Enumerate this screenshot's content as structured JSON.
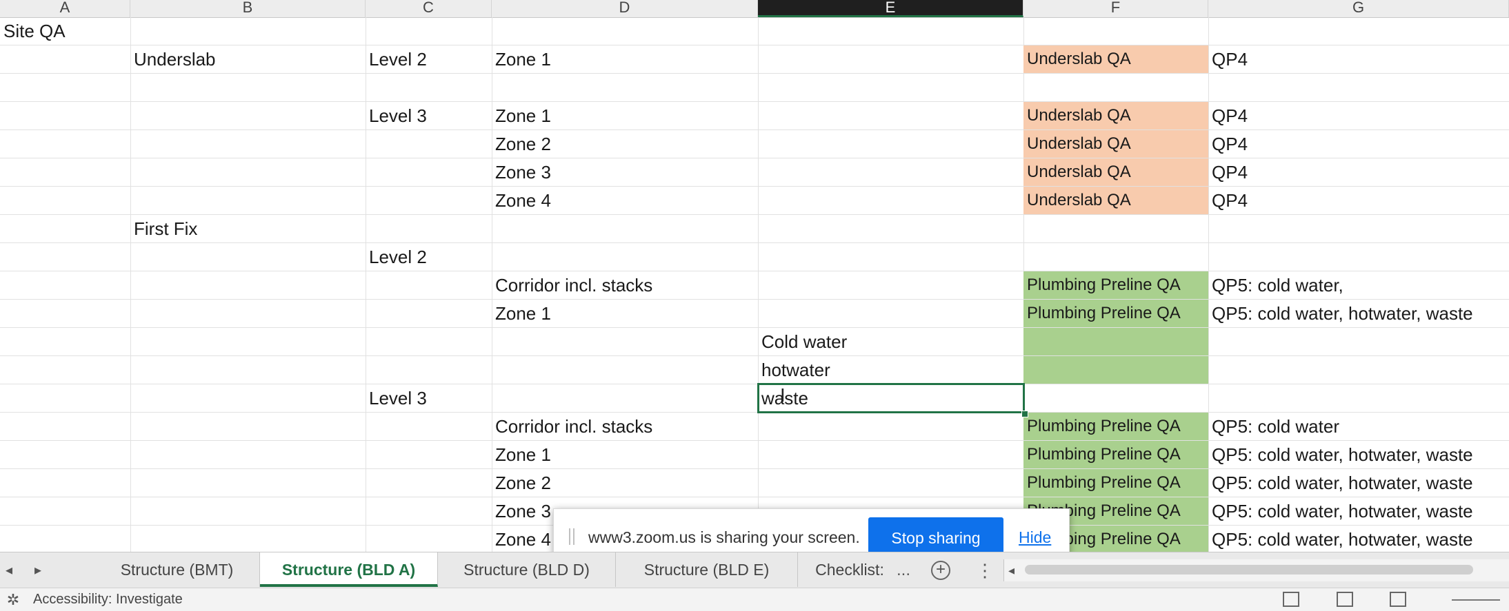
{
  "columns": [
    "A",
    "B",
    "C",
    "D",
    "E",
    "F",
    "G"
  ],
  "selected_column": "E",
  "rows": [
    {
      "a": "Site QA",
      "b": "",
      "c": "",
      "d": "",
      "e": "",
      "f": "",
      "f_fill": "",
      "g": ""
    },
    {
      "a": "",
      "b": "Underslab",
      "c": "Level 2",
      "d": "Zone 1",
      "e": "",
      "f": "Underslab QA",
      "f_fill": "orange",
      "g": "QP4"
    },
    {
      "a": "",
      "b": "",
      "c": "",
      "d": "",
      "e": "",
      "f": "",
      "f_fill": "",
      "g": ""
    },
    {
      "a": "",
      "b": "",
      "c": "Level 3",
      "d": "Zone 1",
      "e": "",
      "f": "Underslab QA",
      "f_fill": "orange",
      "g": "QP4"
    },
    {
      "a": "",
      "b": "",
      "c": "",
      "d": "Zone 2",
      "e": "",
      "f": "Underslab QA",
      "f_fill": "orange",
      "g": "QP4"
    },
    {
      "a": "",
      "b": "",
      "c": "",
      "d": "Zone 3",
      "e": "",
      "f": "Underslab QA",
      "f_fill": "orange",
      "g": "QP4"
    },
    {
      "a": "",
      "b": "",
      "c": "",
      "d": "Zone 4",
      "e": "",
      "f": "Underslab QA",
      "f_fill": "orange",
      "g": "QP4"
    },
    {
      "a": "",
      "b": "First Fix",
      "c": "",
      "d": "",
      "e": "",
      "f": "",
      "f_fill": "",
      "g": ""
    },
    {
      "a": "",
      "b": "",
      "c": "Level 2",
      "d": "",
      "e": "",
      "f": "",
      "f_fill": "",
      "g": ""
    },
    {
      "a": "",
      "b": "",
      "c": "",
      "d": "Corridor incl. stacks",
      "e": "",
      "f": "Plumbing Preline QA",
      "f_fill": "green",
      "g": "QP5: cold water,"
    },
    {
      "a": "",
      "b": "",
      "c": "",
      "d": "Zone 1",
      "e": "",
      "f": "Plumbing Preline QA",
      "f_fill": "green",
      "g": "QP5: cold water, hotwater, waste"
    },
    {
      "a": "",
      "b": "",
      "c": "",
      "d": "",
      "e": "Cold water",
      "f": "",
      "f_fill": "green",
      "g": ""
    },
    {
      "a": "",
      "b": "",
      "c": "",
      "d": "",
      "e": "hotwater",
      "f": "",
      "f_fill": "green",
      "g": ""
    },
    {
      "a": "",
      "b": "",
      "c": "Level 3",
      "d": "",
      "e": "waste",
      "f": "",
      "f_fill": "",
      "g": ""
    },
    {
      "a": "",
      "b": "",
      "c": "",
      "d": "Corridor incl. stacks",
      "e": "",
      "f": "Plumbing Preline QA",
      "f_fill": "green",
      "g": "QP5: cold water"
    },
    {
      "a": "",
      "b": "",
      "c": "",
      "d": "Zone 1",
      "e": "",
      "f": "Plumbing Preline QA",
      "f_fill": "green",
      "g": "QP5: cold water, hotwater, waste"
    },
    {
      "a": "",
      "b": "",
      "c": "",
      "d": "Zone 2",
      "e": "",
      "f": "Plumbing Preline QA",
      "f_fill": "green",
      "g": "QP5: cold water, hotwater, waste"
    },
    {
      "a": "",
      "b": "",
      "c": "",
      "d": "Zone 3",
      "e": "",
      "f": "Plumbing Preline QA",
      "f_fill": "green",
      "g": "QP5: cold water, hotwater, waste"
    },
    {
      "a": "",
      "b": "",
      "c": "",
      "d": "Zone 4",
      "e": "",
      "f": "Plumbing Preline QA",
      "f_fill": "green",
      "g": "QP5: cold water, hotwater, waste"
    }
  ],
  "colors": {
    "orange": "#f8cbad",
    "green": "#a9d08e",
    "accent": "#217346",
    "zoom_blue": "#0e71eb"
  },
  "zoom_banner": {
    "message": "www3.zoom.us is sharing your screen.",
    "stop_label": "Stop sharing",
    "hide_label": "Hide"
  },
  "sheet_tabs": [
    {
      "label": "Structure (BMT)",
      "active": false
    },
    {
      "label": "Structure (BLD A)",
      "active": true
    },
    {
      "label": "Structure (BLD D)",
      "active": false
    },
    {
      "label": "Structure (BLD E)",
      "active": false
    },
    {
      "label": "Checklist:",
      "active": false
    }
  ],
  "tab_overflow": "...",
  "status": {
    "accessibility": "Accessibility: Investigate"
  },
  "icons": [
    "add-sheet-icon",
    "more-icon",
    "accessibility-icon",
    "normal-view-icon",
    "page-layout-icon",
    "page-break-icon",
    "tab-nav-right-icon",
    "scroll-left-icon"
  ]
}
